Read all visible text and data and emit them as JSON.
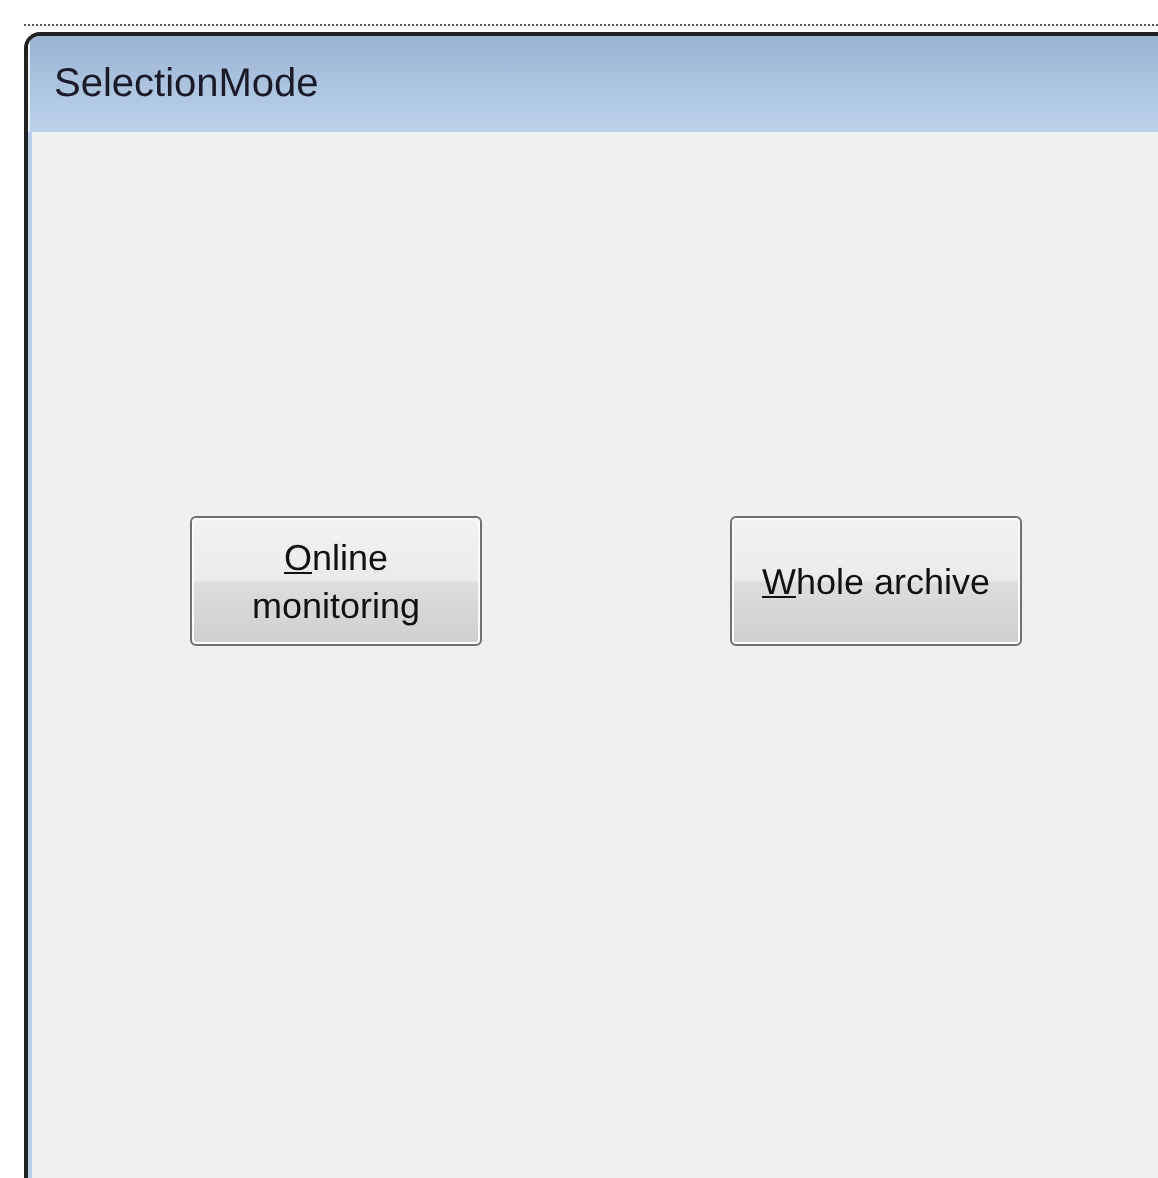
{
  "window": {
    "title": "SelectionMode"
  },
  "buttons": [
    {
      "label": "Online monitoring",
      "access_key": true
    },
    {
      "label": "Whole archive",
      "access_key": true
    }
  ]
}
